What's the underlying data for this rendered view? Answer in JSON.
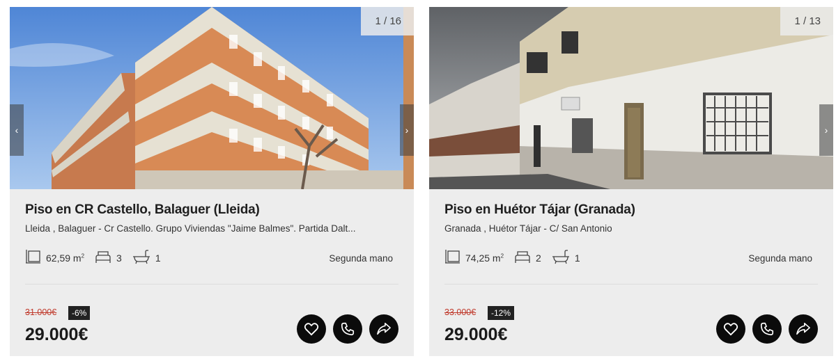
{
  "listings": [
    {
      "photo_counter": "1 / 16",
      "title": "Piso en CR Castello, Balaguer (Lleida)",
      "address": "Lleida , Balaguer - Cr Castello. Grupo Viviendas \"Jaime Balmes\". Partida Dalt...",
      "area": "62,59 m",
      "area_unit_exp": "2",
      "bedrooms": "3",
      "bathrooms": "1",
      "condition": "Segunda mano",
      "old_price": "31.000€",
      "discount": "-6%",
      "price": "29.000€"
    },
    {
      "photo_counter": "1 / 13",
      "title": "Piso en Huétor Tájar (Granada)",
      "address": "Granada , Huétor Tájar - C/ San Antonio",
      "area": "74,25 m",
      "area_unit_exp": "2",
      "bedrooms": "2",
      "bathrooms": "1",
      "condition": "Segunda mano",
      "old_price": "33.000€",
      "discount": "-12%",
      "price": "29.000€"
    }
  ],
  "icons": {
    "area": "area-icon",
    "bed": "bed-icon",
    "bath": "bathtub-icon",
    "favorite": "heart-icon",
    "call": "phone-icon",
    "share": "share-icon",
    "prev": "chevron-left-icon",
    "next": "chevron-right-icon"
  },
  "colors": {
    "card_bg": "#ededed",
    "old_price": "#c0392b",
    "button_bg": "#0b0b0b"
  }
}
